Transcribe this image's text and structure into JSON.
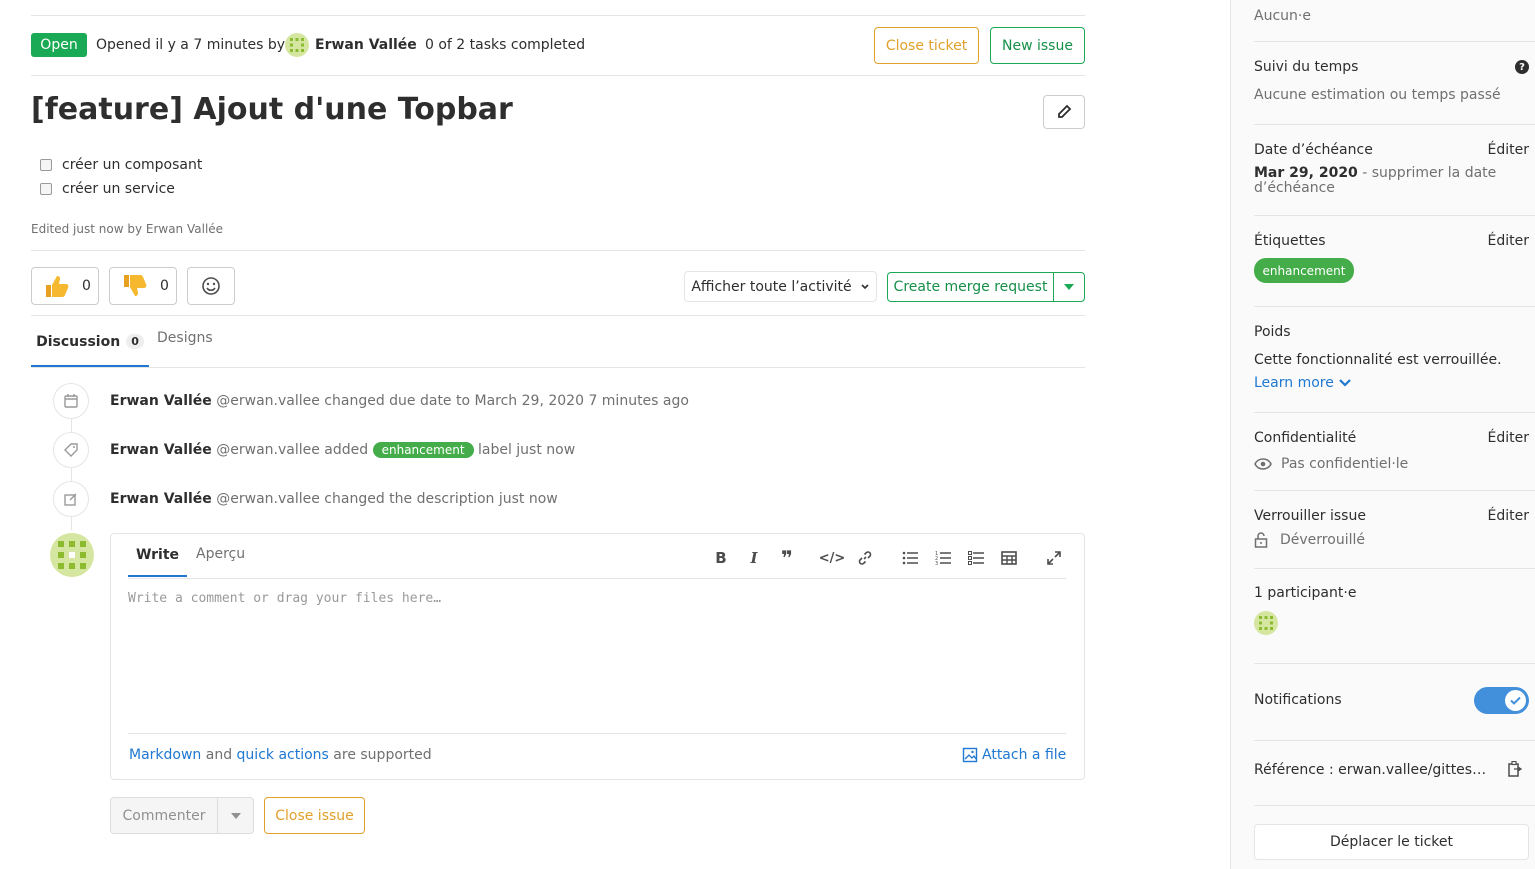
{
  "header": {
    "status": "Open",
    "opened_text": "Opened il y a 7 minutes by",
    "author": "Erwan Vallée",
    "tasks": "0 of 2 tasks completed",
    "close_ticket": "Close ticket",
    "new_issue": "New issue"
  },
  "issue": {
    "title": "[feature] Ajout d'une Topbar",
    "tasks": [
      {
        "label": "créer un composant",
        "checked": false
      },
      {
        "label": "créer un service",
        "checked": false
      }
    ],
    "edited": "Edited just now by Erwan Vallée"
  },
  "awards": {
    "thumbs_up": "0",
    "thumbs_down": "0"
  },
  "activity_filter": "Afficher toute l’activité",
  "merge_request": "Create merge request",
  "tabs": {
    "discussion": "Discussion",
    "discussion_count": "0",
    "designs": "Designs"
  },
  "timeline": [
    {
      "author": "Erwan Vallée",
      "handle": "@erwan.vallee",
      "text": "changed due date to March 29, 2020",
      "time": "7 minutes ago",
      "icon": "calendar-icon"
    },
    {
      "author": "Erwan Vallée",
      "handle": "@erwan.vallee",
      "text_before": "added",
      "label": "enhancement",
      "text_after": "label just now",
      "icon": "tag-icon"
    },
    {
      "author": "Erwan Vallée",
      "handle": "@erwan.vallee",
      "text": "changed the description just now",
      "icon": "pencil-square-icon"
    }
  ],
  "comment": {
    "write_tab": "Write",
    "preview_tab": "Aperçu",
    "placeholder": "Write a comment or drag your files here…",
    "markdown": "Markdown",
    "and": "and",
    "quick_actions": "quick actions",
    "supported": "are supported",
    "attach": "Attach a file",
    "submit": "Commenter",
    "close_issue": "Close issue"
  },
  "sidebar": {
    "assignee_value": "Aucun·e",
    "time_tracking": {
      "title": "Suivi du temps",
      "value": "Aucune estimation ou temps passé"
    },
    "due_date": {
      "title": "Date d’échéance",
      "edit": "Éditer",
      "date": "Mar 29, 2020",
      "remove": "- supprimer la date d’échéance"
    },
    "labels": {
      "title": "Étiquettes",
      "edit": "Éditer",
      "label": "enhancement",
      "label_color": "#44ad4a"
    },
    "weight": {
      "title": "Poids",
      "value": "Cette fonctionnalité est verrouillée.",
      "learn_more": "Learn more"
    },
    "confidentiality": {
      "title": "Confidentialité",
      "edit": "Éditer",
      "value": "Pas confidentiel·le"
    },
    "lock": {
      "title": "Verrouiller issue",
      "edit": "Éditer",
      "value": "Déverrouillé"
    },
    "participants": {
      "title": "1 participant·e"
    },
    "notifications": {
      "title": "Notifications",
      "enabled": true
    },
    "reference": {
      "text": "Référence : erwan.vallee/gittes…"
    },
    "move": "Déplacer le ticket"
  },
  "colors": {
    "green": "#1aaa55",
    "warning": "#e0a02b",
    "link": "#1f78d1",
    "toggle": "#428fdc"
  }
}
